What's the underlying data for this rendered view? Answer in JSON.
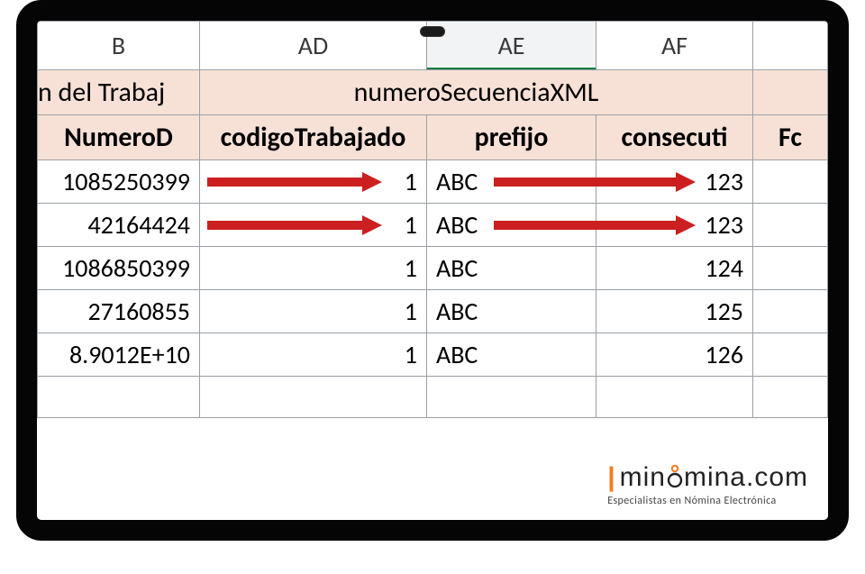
{
  "columns": {
    "B": "B",
    "AD": "AD",
    "AE": "AE",
    "AF": "AF",
    "AG": ""
  },
  "group_header": {
    "left_fragment": "n del Trabaj",
    "merged": "numeroSecuenciaXML"
  },
  "sub_header": {
    "B": "NumeroD",
    "AD": "codigoTrabajado",
    "AE": "prefijo",
    "AF": "consecuti",
    "AG": "Fc"
  },
  "rows": [
    {
      "B": "1085250399",
      "AD": "1",
      "AE": "ABC",
      "AF": "123",
      "arrows": true
    },
    {
      "B": "42164424",
      "AD": "1",
      "AE": "ABC",
      "AF": "123",
      "arrows": true
    },
    {
      "B": "1086850399",
      "AD": "1",
      "AE": "ABC",
      "AF": "124",
      "arrows": false
    },
    {
      "B": "27160855",
      "AD": "1",
      "AE": "ABC",
      "AF": "125",
      "arrows": false
    },
    {
      "B": "8.9012E+10",
      "AD": "1",
      "AE": "ABC",
      "AF": "126",
      "arrows": false
    },
    {
      "B": "",
      "AD": "",
      "AE": "",
      "AF": "",
      "arrows": false
    }
  ],
  "logo": {
    "brand_pre": "min",
    "brand_post": "mina.com",
    "tagline": "Especialistas en Nómina Electrónica"
  },
  "colors": {
    "arrow": "#cc1f1f",
    "excel_green": "#107c41",
    "header_fill": "#f7e1d7",
    "logo_accent": "#f57c1f"
  }
}
